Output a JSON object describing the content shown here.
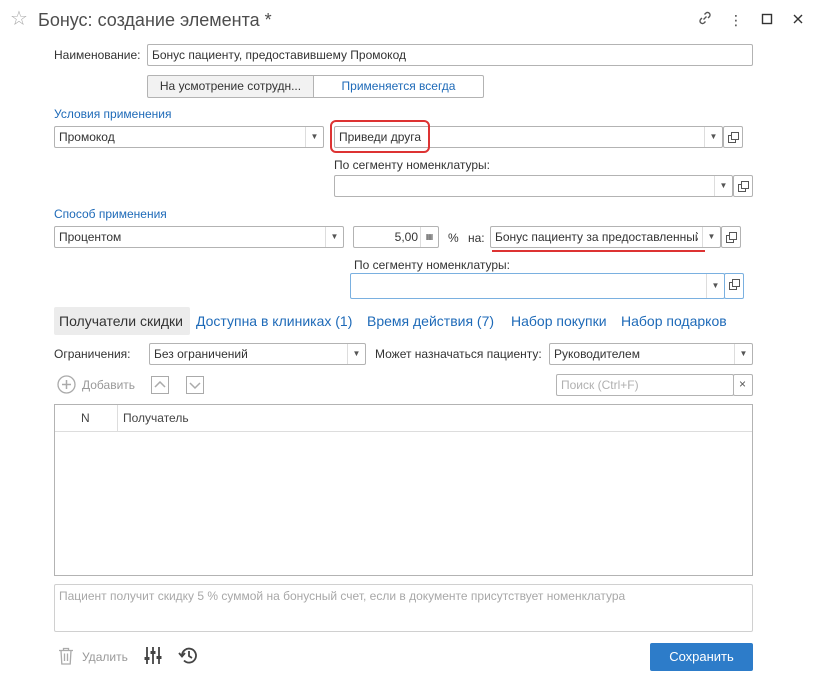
{
  "window": {
    "title": "Бонус: создание элемента *"
  },
  "form": {
    "name_label": "Наименование:",
    "name_value": "Бонус пациенту, предоставившему Промокод",
    "toggle_options": [
      "На усмотрение сотрудн...",
      "Применяется всегда"
    ],
    "toggle_selected": "Применяется всегда"
  },
  "conditions": {
    "section_label": "Условия применения",
    "type_value": "Промокод",
    "promo_value": "Приведи друга",
    "segment_label": "По сегменту номенклатуры:",
    "segment_value": ""
  },
  "method": {
    "section_label": "Способ применения",
    "type_value": "Процентом",
    "amount_value": "5,00",
    "percent_label": "%",
    "on_label": "на:",
    "bonus_value": "Бонус пациенту за предоставленный",
    "segment_label": "По сегменту номенклатуры:",
    "segment_value": ""
  },
  "tabs": [
    {
      "label": "Получатели скидки",
      "active": true
    },
    {
      "label": "Доступна в клиниках (1)",
      "active": false
    },
    {
      "label": "Время действия (7)",
      "active": false
    },
    {
      "label": "Набор покупки",
      "active": false
    },
    {
      "label": "Набор подарков",
      "active": false
    }
  ],
  "recipients": {
    "limit_label": "Ограничения:",
    "limit_value": "Без ограничений",
    "assign_label": "Может назначаться пациенту:",
    "assign_value": "Руководителем",
    "add_label": "Добавить",
    "search_placeholder": "Поиск (Ctrl+F)",
    "columns": [
      "N",
      "Получатель"
    ],
    "rows": []
  },
  "note": {
    "text": "Пациент получит скидку 5 % суммой на бонусный счет, если в документе присутствует номенклатура"
  },
  "footer": {
    "delete_label": "Удалить",
    "save_label": "Сохранить"
  },
  "colors": {
    "accent": "#1e6ab8",
    "primary_button": "#2d7cc9",
    "highlight_red": "#dd3333"
  }
}
